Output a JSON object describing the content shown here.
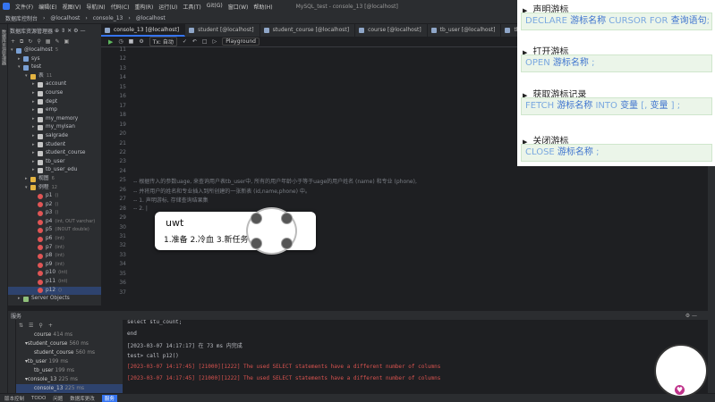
{
  "menubar": {
    "items": [
      "文件(F)",
      "编辑(E)",
      "视图(V)",
      "导航(N)",
      "代码(C)",
      "重构(R)",
      "运行(U)",
      "工具(T)",
      "Git(G)",
      "窗口(W)",
      "帮助(H)"
    ],
    "title": "MySQL_test - console_13 [@localhost]"
  },
  "breadcrumb": {
    "items": [
      "数据库控制台",
      "@localhost",
      "console_13",
      "@localhost"
    ]
  },
  "project_panel": {
    "title": "数据库资源管理器",
    "tree": [
      {
        "arrow": "▾",
        "icon": "db",
        "label": "@localhost",
        "extra": "5",
        "indent": 0
      },
      {
        "arrow": "▸",
        "icon": "db",
        "label": "sys",
        "extra": "",
        "indent": 1
      },
      {
        "arrow": "▾",
        "icon": "db",
        "label": "test",
        "extra": "",
        "indent": 1
      },
      {
        "arrow": "▾",
        "icon": "fo",
        "label": "表",
        "extra": "11",
        "indent": 2
      },
      {
        "arrow": "▸",
        "icon": "tbl",
        "label": "account",
        "extra": "",
        "indent": 3
      },
      {
        "arrow": "▸",
        "icon": "tbl",
        "label": "course",
        "extra": "",
        "indent": 3
      },
      {
        "arrow": "▸",
        "icon": "tbl",
        "label": "dept",
        "extra": "",
        "indent": 3
      },
      {
        "arrow": "▸",
        "icon": "tbl",
        "label": "emp",
        "extra": "",
        "indent": 3
      },
      {
        "arrow": "▸",
        "icon": "tbl",
        "label": "my_memory",
        "extra": "",
        "indent": 3
      },
      {
        "arrow": "▸",
        "icon": "tbl",
        "label": "my_myisan",
        "extra": "",
        "indent": 3
      },
      {
        "arrow": "▸",
        "icon": "tbl",
        "label": "salgrade",
        "extra": "",
        "indent": 3
      },
      {
        "arrow": "▸",
        "icon": "tbl",
        "label": "student",
        "extra": "",
        "indent": 3
      },
      {
        "arrow": "▸",
        "icon": "tbl",
        "label": "student_course",
        "extra": "",
        "indent": 3
      },
      {
        "arrow": "▸",
        "icon": "tbl",
        "label": "tb_user",
        "extra": "",
        "indent": 3
      },
      {
        "arrow": "▸",
        "icon": "tbl",
        "label": "tb_user_edu",
        "extra": "",
        "indent": 3
      },
      {
        "arrow": "▸",
        "icon": "fo",
        "label": "视图",
        "extra": "6",
        "indent": 2
      },
      {
        "arrow": "▾",
        "icon": "fo",
        "label": "例程",
        "extra": "12",
        "indent": 2
      },
      {
        "arrow": "",
        "icon": "fn",
        "label": "p1",
        "extra": "()",
        "indent": 3
      },
      {
        "arrow": "",
        "icon": "fn",
        "label": "p2",
        "extra": "()",
        "indent": 3
      },
      {
        "arrow": "",
        "icon": "fn",
        "label": "p3",
        "extra": "()",
        "indent": 3
      },
      {
        "arrow": "",
        "icon": "fn",
        "label": "p4",
        "extra": "(int, OUT varchar)",
        "indent": 3
      },
      {
        "arrow": "",
        "icon": "fn",
        "label": "p5",
        "extra": "(INOUT double)",
        "indent": 3
      },
      {
        "arrow": "",
        "icon": "fn",
        "label": "p6",
        "extra": "(int)",
        "indent": 3
      },
      {
        "arrow": "",
        "icon": "fn",
        "label": "p7",
        "extra": "(int)",
        "indent": 3
      },
      {
        "arrow": "",
        "icon": "fn",
        "label": "p8",
        "extra": "(int)",
        "indent": 3
      },
      {
        "arrow": "",
        "icon": "fn",
        "label": "p9",
        "extra": "(int)",
        "indent": 3
      },
      {
        "arrow": "",
        "icon": "fn",
        "label": "p10",
        "extra": "(int)",
        "indent": 3
      },
      {
        "arrow": "",
        "icon": "fn",
        "label": "p11",
        "extra": "(int)",
        "indent": 3
      },
      {
        "arrow": "",
        "icon": "fn",
        "label": "p12",
        "extra": "()",
        "indent": 3
      },
      {
        "arrow": "▸",
        "icon": "sv",
        "label": "Server Objects",
        "extra": "",
        "indent": 1
      }
    ]
  },
  "tabs": [
    {
      "label": "console_13 [@localhost]",
      "active": true
    },
    {
      "label": "student [@localhost]",
      "active": false
    },
    {
      "label": "student_course [@localhost]",
      "active": false
    },
    {
      "label": "course [@localhost]",
      "active": false
    },
    {
      "label": "tb_user [@localhost]",
      "active": false
    },
    {
      "label": "tb_use",
      "active": false
    }
  ],
  "editor_toolbar": {
    "tx": "Tx: 自动",
    "playground": "Playground"
  },
  "editor": {
    "line_numbers": [
      "11",
      "12",
      "13",
      "14",
      "15",
      "16",
      "17",
      "18",
      "19",
      "20",
      "21",
      "22",
      "23",
      "24",
      "25",
      "26",
      "27",
      "28",
      "29",
      "30",
      "31",
      "32",
      "33",
      "34",
      "35",
      "36",
      "37"
    ],
    "lines": [
      {
        "n": "25",
        "text": "-- 根据传入的参数uage, 来查询用户表tb_user中, 所有的用户年龄小于等于uage的用户姓名 (name) 和专业 (phone),"
      },
      {
        "n": "26",
        "text": "-- 并将用户的姓名和专业插入到所创建的一张新表 (id,name,phone) 中。"
      },
      {
        "n": "27",
        "text": "-- 1. 声明游标, 存储查询结果集"
      },
      {
        "n": "28",
        "text": "-- 2. |"
      }
    ]
  },
  "services": {
    "title": "服务",
    "list": [
      {
        "label": "course",
        "ms": "414 ms",
        "indent": 2,
        "arrow": ""
      },
      {
        "label": "student_course",
        "ms": "560 ms",
        "indent": 1,
        "arrow": "▾"
      },
      {
        "label": "student_course",
        "ms": "560 ms",
        "indent": 2,
        "arrow": ""
      },
      {
        "label": "tb_user",
        "ms": "199 ms",
        "indent": 1,
        "arrow": "▾"
      },
      {
        "label": "tb_user",
        "ms": "199 ms",
        "indent": 2,
        "arrow": ""
      },
      {
        "label": "console_13",
        "ms": "225 ms",
        "indent": 1,
        "arrow": "▾"
      },
      {
        "label": "console_13",
        "ms": "225 ms",
        "indent": 2,
        "arrow": "",
        "selected": true
      }
    ],
    "console": [
      {
        "type": "w",
        "text": "        select stu_count;"
      },
      {
        "type": "w",
        "text": "    end"
      },
      {
        "type": "w",
        "text": "[2023-03-07 14:17:17] 在 73 ms 内完成"
      },
      {
        "type": "w",
        "text": "test> call p12()"
      },
      {
        "type": "e",
        "text": "[2023-03-07 14:17:45] [21000][1222] The used SELECT statements have a different number of columns"
      },
      {
        "type": "e",
        "text": "[2023-03-07 14:17:45] [21000][1222] The used SELECT statements have a different number of columns"
      }
    ]
  },
  "statusbar": {
    "items": [
      "版本控制",
      "TODO",
      "问题",
      "数据库更改",
      "服务"
    ]
  },
  "notes": [
    {
      "heading": "声明游标",
      "code": [
        {
          "t": "DECLARE ",
          "c": "kw"
        },
        {
          "t": "游标名称",
          "c": "cn"
        },
        {
          "t": " CURSOR FOR ",
          "c": "kw"
        },
        {
          "t": "查询语句",
          "c": "cn"
        },
        {
          "t": ";",
          "c": "kw"
        }
      ]
    },
    {
      "heading": "打开游标",
      "code": [
        {
          "t": "OPEN ",
          "c": "kw"
        },
        {
          "t": "游标名称",
          "c": "cn"
        },
        {
          "t": " ;",
          "c": "kw"
        }
      ]
    },
    {
      "heading": "获取游标记录",
      "code": [
        {
          "t": "FETCH ",
          "c": "kw"
        },
        {
          "t": "游标名称",
          "c": "cn"
        },
        {
          "t": " INTO ",
          "c": "kw"
        },
        {
          "t": "变量",
          "c": "cn"
        },
        {
          "t": " [, ",
          "c": "kw"
        },
        {
          "t": "变量",
          "c": "cn"
        },
        {
          "t": " ] ;",
          "c": "kw"
        }
      ]
    },
    {
      "heading": "关闭游标",
      "code": [
        {
          "t": "CLOSE ",
          "c": "kw"
        },
        {
          "t": "游标名称",
          "c": "cn"
        },
        {
          "t": " ;",
          "c": "kw"
        }
      ]
    }
  ],
  "ime": {
    "input": "uwt",
    "candidates": "1.准备 2.冷血 3.新任务"
  }
}
